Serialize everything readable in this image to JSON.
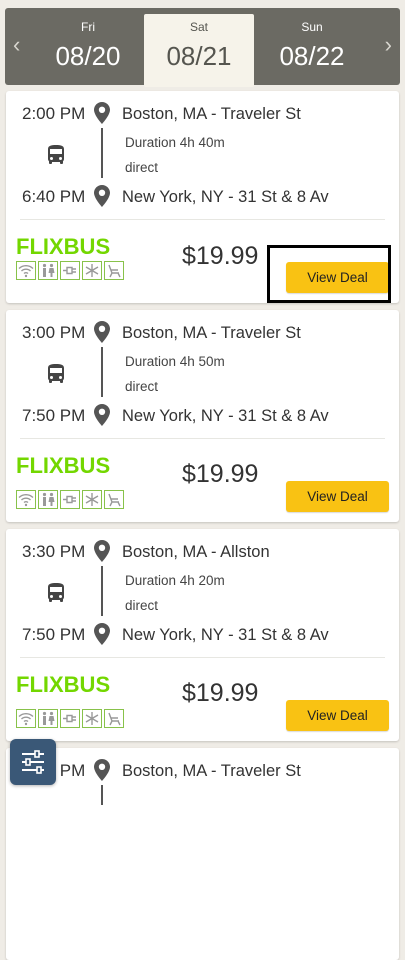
{
  "dates": [
    {
      "day": "Fri",
      "date": "08/20",
      "selected": false
    },
    {
      "day": "Sat",
      "date": "08/21",
      "selected": true
    },
    {
      "day": "Sun",
      "date": "08/22",
      "selected": false
    }
  ],
  "trips": [
    {
      "depart_time": "2:00 PM",
      "depart_place": "Boston, MA - Traveler St",
      "duration": "Duration 4h 40m",
      "route_type": "direct",
      "arrive_time": "6:40 PM",
      "arrive_place": "New York, NY - 31 St & 8 Av",
      "carrier": "FLIXBUS",
      "price": "$19.99",
      "cta": "View Deal"
    },
    {
      "depart_time": "3:00 PM",
      "depart_place": "Boston, MA - Traveler St",
      "duration": "Duration 4h 50m",
      "route_type": "direct",
      "arrive_time": "7:50 PM",
      "arrive_place": "New York, NY - 31 St & 8 Av",
      "carrier": "FLIXBUS",
      "price": "$19.99",
      "cta": "View Deal"
    },
    {
      "depart_time": "3:30 PM",
      "depart_place": "Boston, MA - Allston",
      "duration": "Duration 4h 20m",
      "route_type": "direct",
      "arrive_time": "7:50 PM",
      "arrive_place": "New York, NY - 31 St & 8 Av",
      "carrier": "FLIXBUS",
      "price": "$19.99",
      "cta": "View Deal"
    },
    {
      "depart_time": "3:30 PM",
      "depart_place": "Boston, MA - Traveler St"
    }
  ],
  "amenities": [
    "wifi-icon",
    "restroom-icon",
    "power-outlet-icon",
    "air-conditioning-icon",
    "reclining-seat-icon"
  ],
  "colors": {
    "accent": "#f9c213",
    "brand_green": "#73d700",
    "date_bar": "#6b6a63",
    "filter_button": "#3a5877"
  }
}
